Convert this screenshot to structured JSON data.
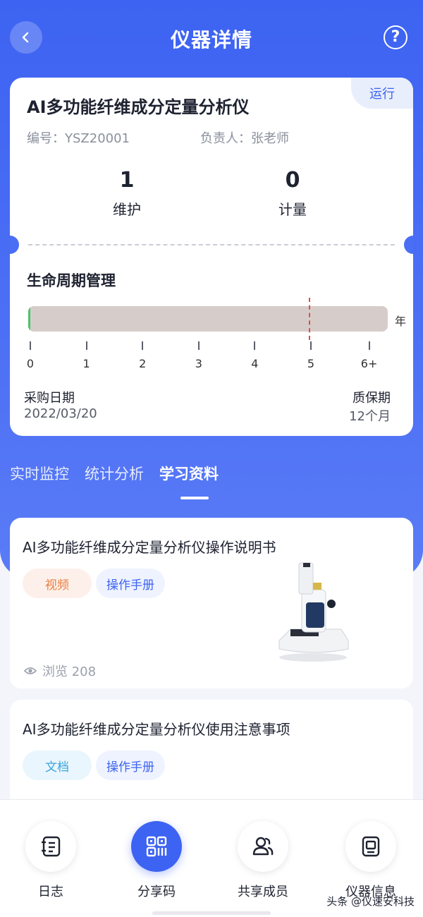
{
  "header": {
    "title": "仪器详情"
  },
  "instrument": {
    "name": "AI多功能纤维成分定量分析仪",
    "status": "运行",
    "code_label": "编号：YSZ20001",
    "owner_label": "负责人：张老师",
    "stats": [
      {
        "value": "1",
        "label": "维护"
      },
      {
        "value": "0",
        "label": "计量"
      }
    ]
  },
  "lifecycle": {
    "title": "生命周期管理",
    "unit": "年",
    "ticks": [
      "0",
      "1",
      "2",
      "3",
      "4",
      "5",
      "6+"
    ],
    "marker_year": 5,
    "fill_fraction": 0.006,
    "purchase_label": "采购日期",
    "purchase_date": "2022/03/20",
    "warranty_label": "质保期",
    "warranty_value": "12个月"
  },
  "tabs": [
    {
      "label": "实时监控",
      "active": false
    },
    {
      "label": "统计分析",
      "active": false
    },
    {
      "label": "学习资料",
      "active": true
    }
  ],
  "documents": [
    {
      "title": "AI多功能纤维成分定量分析仪操作说明书",
      "tags": [
        "视频",
        "操作手册"
      ],
      "views": "浏览 208"
    },
    {
      "title": "AI多功能纤维成分定量分析仪使用注意事项",
      "tags": [
        "文档",
        "操作手册"
      ]
    }
  ],
  "bottom_nav": [
    {
      "label": "日志",
      "icon": "log-icon"
    },
    {
      "label": "分享码",
      "icon": "qrcode-icon"
    },
    {
      "label": "共享成员",
      "icon": "members-icon"
    },
    {
      "label": "仪器信息",
      "icon": "device-info-icon"
    }
  ],
  "watermark": "头条 @仪速安科技",
  "colors": {
    "primary": "#3d63f2",
    "warning_line": "#e34a4a",
    "progress_fill": "#49c46a"
  }
}
